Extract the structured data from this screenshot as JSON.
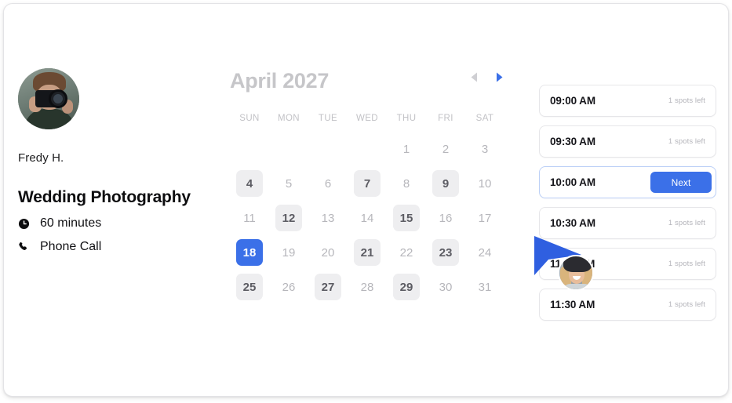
{
  "profile": {
    "avatar_icon": "photographer-avatar",
    "host_name": "Fredy H.",
    "service_title": "Wedding Photography",
    "duration_icon": "clock-icon",
    "duration": "60 minutes",
    "location_icon": "phone-icon",
    "location": "Phone Call"
  },
  "calendar": {
    "title": "April 2027",
    "prev_icon": "chevron-left-icon",
    "next_icon": "chevron-right-icon",
    "prev_color": "#cfcfd3",
    "next_color": "#3b70e8",
    "weekdays": [
      "SUN",
      "MON",
      "TUE",
      "WED",
      "THU",
      "FRI",
      "SAT"
    ],
    "leading_blanks": 4,
    "days": [
      {
        "n": "1",
        "state": "disabled"
      },
      {
        "n": "2",
        "state": "disabled"
      },
      {
        "n": "3",
        "state": "disabled"
      },
      {
        "n": "4",
        "state": "available"
      },
      {
        "n": "5",
        "state": "disabled"
      },
      {
        "n": "6",
        "state": "disabled"
      },
      {
        "n": "7",
        "state": "available"
      },
      {
        "n": "8",
        "state": "disabled"
      },
      {
        "n": "9",
        "state": "available"
      },
      {
        "n": "10",
        "state": "disabled"
      },
      {
        "n": "11",
        "state": "disabled"
      },
      {
        "n": "12",
        "state": "available"
      },
      {
        "n": "13",
        "state": "disabled"
      },
      {
        "n": "14",
        "state": "disabled"
      },
      {
        "n": "15",
        "state": "available"
      },
      {
        "n": "16",
        "state": "disabled"
      },
      {
        "n": "17",
        "state": "disabled"
      },
      {
        "n": "18",
        "state": "selected"
      },
      {
        "n": "19",
        "state": "disabled"
      },
      {
        "n": "20",
        "state": "disabled"
      },
      {
        "n": "21",
        "state": "available"
      },
      {
        "n": "22",
        "state": "disabled"
      },
      {
        "n": "23",
        "state": "available"
      },
      {
        "n": "24",
        "state": "disabled"
      },
      {
        "n": "25",
        "state": "available"
      },
      {
        "n": "26",
        "state": "disabled"
      },
      {
        "n": "27",
        "state": "available"
      },
      {
        "n": "28",
        "state": "disabled"
      },
      {
        "n": "29",
        "state": "available"
      },
      {
        "n": "30",
        "state": "disabled"
      },
      {
        "n": "31",
        "state": "disabled"
      }
    ]
  },
  "slots": {
    "items": [
      {
        "time": "09:00 AM",
        "spots": "1 spots left",
        "selected": false
      },
      {
        "time": "09:30 AM",
        "spots": "1 spots left",
        "selected": false
      },
      {
        "time": "10:00 AM",
        "spots": "",
        "selected": true
      },
      {
        "time": "10:30 AM",
        "spots": "1 spots left",
        "selected": false
      },
      {
        "time": "11:00 AM",
        "spots": "1 spots left",
        "selected": false
      },
      {
        "time": "11:30 AM",
        "spots": "1 spots left",
        "selected": false
      }
    ],
    "next_label": "Next"
  },
  "cursor": {
    "icon": "pointer-cursor",
    "color": "#2f5fe0",
    "avatar_icon": "collaborator-avatar"
  },
  "colors": {
    "accent": "#3b70e8",
    "available_bg": "#eeeef0",
    "muted_text": "#b6b6bb"
  }
}
